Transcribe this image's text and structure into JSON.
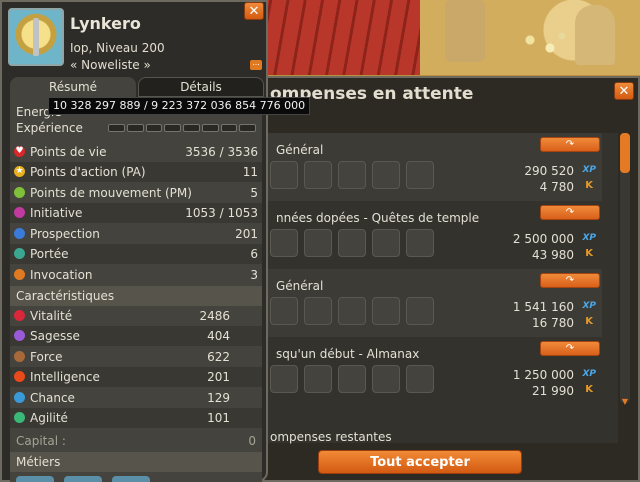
{
  "character": {
    "name": "Lynkero",
    "class_level": "Iop, Niveau 200",
    "title": "« Noweliste »",
    "tabs": [
      "Résumé",
      "Détails"
    ],
    "energy_label": "Energie",
    "experience_label": "Expérience",
    "experience_tooltip": "10 328 297 889 / 9 223 372 036 854 776 000",
    "stats": [
      {
        "label": "Points de vie",
        "value": "3536 / 3536",
        "icon": "heart-icon",
        "color": "#d8282a"
      },
      {
        "label": "Points d'action (PA)",
        "value": "11",
        "icon": "star-icon",
        "color": "#e8b020"
      },
      {
        "label": "Points de mouvement (PM)",
        "value": "5",
        "icon": "boot-icon",
        "color": "#7fbf3a"
      },
      {
        "label": "Initiative",
        "value": "1053 / 1053",
        "icon": "initiative-icon",
        "color": "#c03aa0"
      },
      {
        "label": "Prospection",
        "value": "201",
        "icon": "prospection-icon",
        "color": "#3a7ad8"
      },
      {
        "label": "Portée",
        "value": "6",
        "icon": "range-icon",
        "color": "#3aa890"
      },
      {
        "label": "Invocation",
        "value": "3",
        "icon": "invocation-icon",
        "color": "#e07a22"
      }
    ],
    "characteristics_title": "Caractéristiques",
    "characteristics": [
      {
        "label": "Vitalité",
        "value": "2486",
        "icon": "vitality-icon",
        "color": "#d8283a"
      },
      {
        "label": "Sagesse",
        "value": "404",
        "icon": "wisdom-icon",
        "color": "#9a5ad8"
      },
      {
        "label": "Force",
        "value": "622",
        "icon": "strength-icon",
        "color": "#a8693a"
      },
      {
        "label": "Intelligence",
        "value": "201",
        "icon": "intelligence-icon",
        "color": "#e84a1a"
      },
      {
        "label": "Chance",
        "value": "129",
        "icon": "chance-icon",
        "color": "#3a9ad8"
      },
      {
        "label": "Agilité",
        "value": "101",
        "icon": "agility-icon",
        "color": "#3ab878"
      }
    ],
    "capital_label": "Capital :",
    "capital_value": "0",
    "jobs_title": "Métiers"
  },
  "rewards_window": {
    "title": "ompenses en attente",
    "rewards": [
      {
        "name": "Général",
        "xp": "290 520",
        "kamas": "4 780"
      },
      {
        "name": "nnées dopées - Quêtes de temple",
        "xp": "2 500 000",
        "kamas": "43 980"
      },
      {
        "name": "Général",
        "xp": "1 541 160",
        "kamas": "16 780"
      },
      {
        "name": "squ'un début - Almanax",
        "xp": "1 250 000",
        "kamas": "21 990"
      }
    ],
    "xp_label": "XP",
    "kama_label": "K",
    "remaining": "ompenses restantes",
    "accept_all": "Tout accepter"
  },
  "icons": {
    "close": "✕",
    "claim": "↷",
    "scroll_down": "▼"
  }
}
